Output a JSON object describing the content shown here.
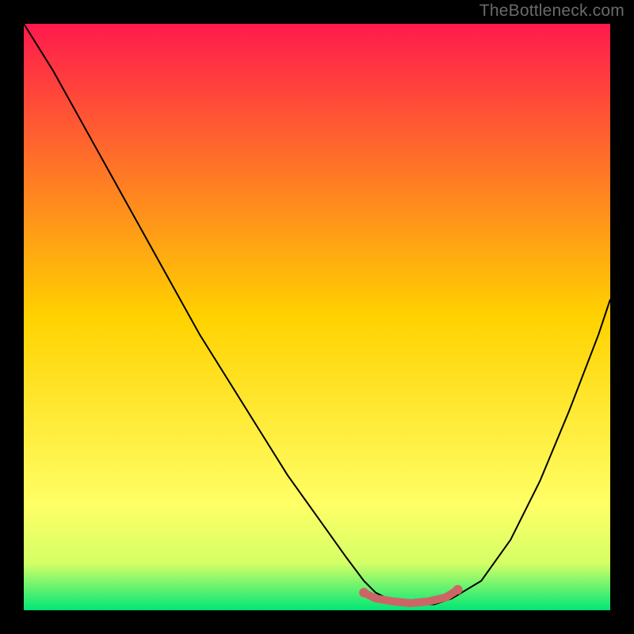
{
  "watermark": "TheBottleneck.com",
  "chart_data": {
    "type": "line",
    "title": "",
    "xlabel": "",
    "ylabel": "",
    "xlim": [
      0,
      100
    ],
    "ylim": [
      0,
      100
    ],
    "background_gradient": {
      "stops": [
        {
          "offset": 0.0,
          "color": "#ff1a4d"
        },
        {
          "offset": 0.5,
          "color": "#ffd200"
        },
        {
          "offset": 0.82,
          "color": "#ffff66"
        },
        {
          "offset": 0.92,
          "color": "#d4ff66"
        },
        {
          "offset": 1.0,
          "color": "#00e676"
        }
      ]
    },
    "series": [
      {
        "name": "bottleneck-curve",
        "color": "#000000",
        "x": [
          0,
          5,
          10,
          15,
          20,
          25,
          30,
          35,
          40,
          45,
          50,
          55,
          58,
          60,
          63,
          66,
          70,
          73,
          78,
          83,
          88,
          93,
          98,
          100
        ],
        "y": [
          100,
          92,
          83,
          74,
          65,
          56,
          47,
          39,
          31,
          23,
          16,
          9,
          5,
          3,
          1.5,
          1,
          1,
          2,
          5,
          12,
          22,
          34,
          47,
          53
        ]
      }
    ],
    "highlight": {
      "name": "optimal-zone",
      "color": "#cc6666",
      "x": [
        58,
        60,
        63,
        66,
        69,
        72,
        74
      ],
      "y": [
        3.0,
        2.0,
        1.5,
        1.2,
        1.5,
        2.2,
        3.5
      ]
    }
  }
}
